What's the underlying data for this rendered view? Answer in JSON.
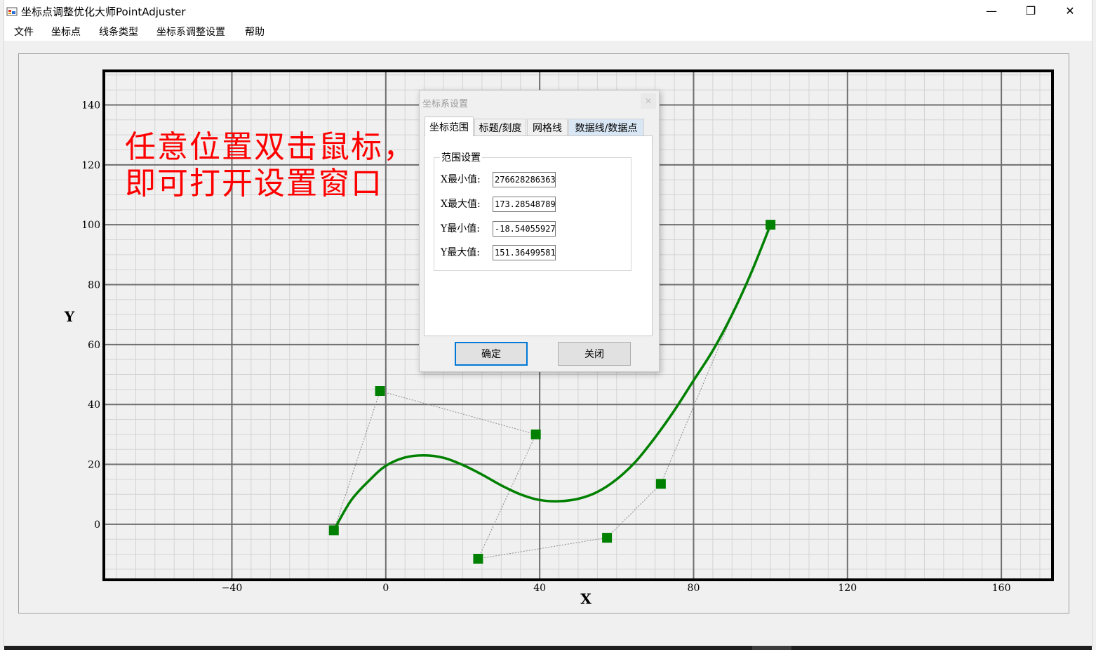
{
  "window": {
    "title": "坐标点调整优化大师PointAdjuster",
    "controls": {
      "minimize": "—",
      "restore": "❐",
      "close": "✕"
    }
  },
  "menu": [
    "文件",
    "坐标点",
    "线条类型",
    "坐标系调整设置",
    "帮助"
  ],
  "annotation": {
    "line1": "任意位置双击鼠标，",
    "line2": "即可打开设置窗口",
    "color": "#ff0000"
  },
  "chart_data": {
    "type": "line",
    "xlabel": "X",
    "ylabel": "Y",
    "xlim": [
      -73.28,
      173.29
    ],
    "ylim": [
      -18.54,
      151.36
    ],
    "x_ticks": [
      -40,
      0,
      40,
      80,
      120,
      160
    ],
    "y_ticks": [
      0,
      20,
      40,
      60,
      80,
      100,
      120,
      140
    ],
    "x_minor_step": 5,
    "y_minor_step": 5,
    "grid": true,
    "series": [
      {
        "role": "control_points",
        "style": "dotted-polyline-square-markers",
        "color": "#008000",
        "points": [
          [
            -13.5,
            -2
          ],
          [
            -1.5,
            44.5
          ],
          [
            39,
            30
          ],
          [
            24,
            -11.5
          ],
          [
            57.5,
            -4.5
          ],
          [
            71.5,
            13.5
          ],
          [
            100,
            100
          ]
        ]
      },
      {
        "role": "fitted_curve",
        "style": "smooth-line",
        "color": "#008000",
        "points": [
          [
            -13.5,
            -2
          ],
          [
            -9,
            8
          ],
          [
            -4,
            15
          ],
          [
            0,
            19.5
          ],
          [
            5,
            22.3
          ],
          [
            10,
            23
          ],
          [
            15,
            22.2
          ],
          [
            20,
            19.8
          ],
          [
            25,
            16.6
          ],
          [
            30,
            13
          ],
          [
            35,
            10
          ],
          [
            40,
            8.1
          ],
          [
            45,
            7.7
          ],
          [
            50,
            8.5
          ],
          [
            55,
            10.8
          ],
          [
            60,
            15
          ],
          [
            65,
            21
          ],
          [
            70,
            29
          ],
          [
            75,
            38
          ],
          [
            80,
            48
          ],
          [
            85,
            58
          ],
          [
            90,
            70
          ],
          [
            95,
            84
          ],
          [
            100,
            100
          ]
        ]
      }
    ]
  },
  "dialog": {
    "title": "坐标系设置",
    "close_glyph": "✕",
    "tabs": [
      "坐标范围",
      "标题/刻度",
      "网格线",
      "数据线/数据点"
    ],
    "group_title": "范围设置",
    "fields": [
      {
        "label": "X最小值:",
        "value": "276628286363"
      },
      {
        "label": "X最大值:",
        "value": "173.28548789"
      },
      {
        "label": "Y最小值:",
        "value": "-18.54055927"
      },
      {
        "label": "Y最大值:",
        "value": "151.36499581"
      }
    ],
    "ok_label": "确定",
    "close_label": "关闭"
  }
}
